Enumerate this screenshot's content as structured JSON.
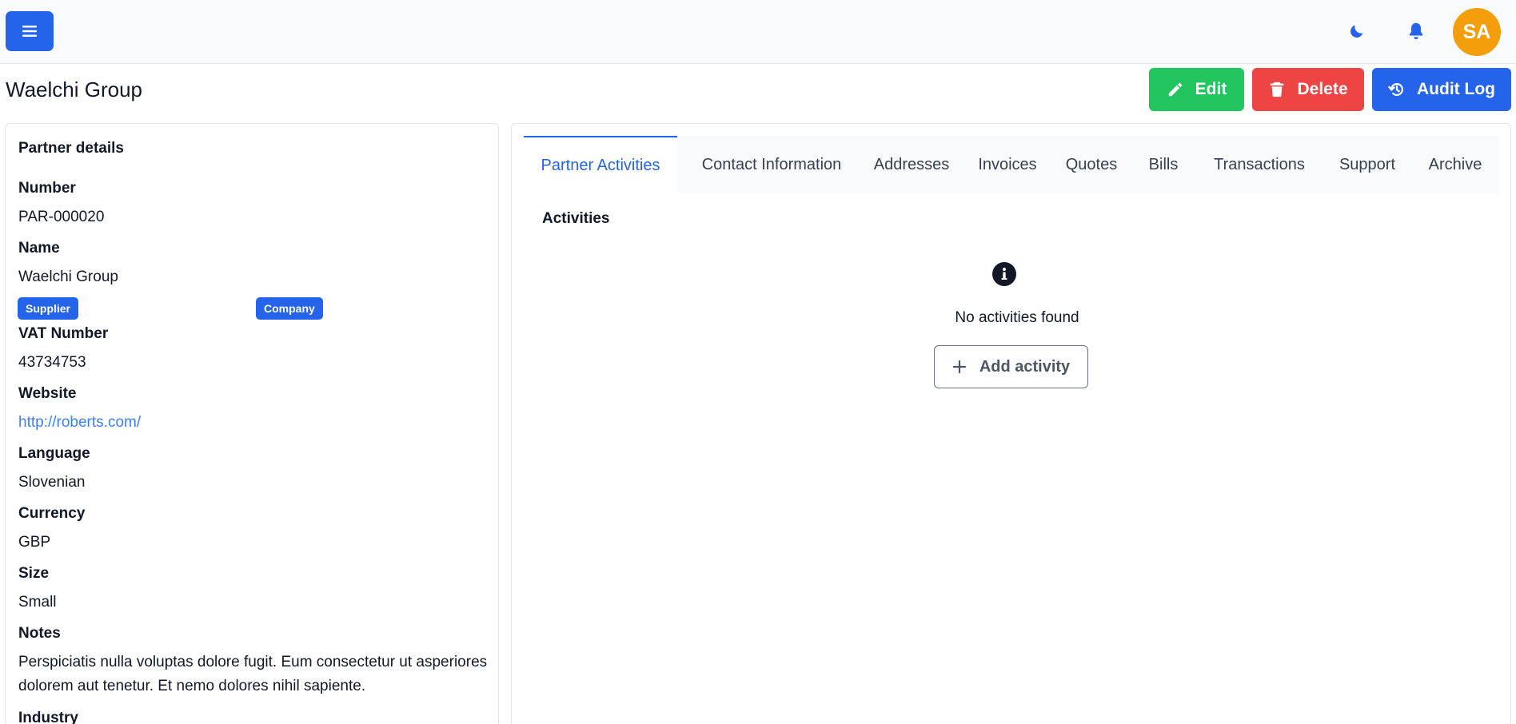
{
  "topbar": {
    "menu_icon": "hamburger-icon",
    "theme_icon": "moon-icon",
    "notification_icon": "bell-icon",
    "avatar_initials": "SA",
    "avatar_color": "#f59e0b"
  },
  "page": {
    "title": "Waelchi Group"
  },
  "actions": {
    "edit_label": "Edit",
    "delete_label": "Delete",
    "audit_label": "Audit Log",
    "edit_color": "#22c55e",
    "delete_color": "#ef4444",
    "audit_color": "#2563eb"
  },
  "partner": {
    "heading": "Partner details",
    "number_label": "Number",
    "number_value": "PAR-000020",
    "name_label": "Name",
    "name_value": "Waelchi Group",
    "badges": [
      "Supplier",
      "Company"
    ],
    "vat_label": "VAT Number",
    "vat_value": "43734753",
    "website_label": "Website",
    "website_value": "http://roberts.com/",
    "language_label": "Language",
    "language_value": "Slovenian",
    "currency_label": "Currency",
    "currency_value": "GBP",
    "size_label": "Size",
    "size_value": "Small",
    "notes_label": "Notes",
    "notes_value": "Perspiciatis nulla voluptas dolore fugit. Eum consectetur ut asperiores dolorem aut tenetur. Et nemo dolores nihil sapiente.",
    "industry_label": "Industry"
  },
  "tabs": [
    {
      "label": "Partner Activities",
      "active": true
    },
    {
      "label": "Contact Information",
      "active": false
    },
    {
      "label": "Addresses",
      "active": false
    },
    {
      "label": "Invoices",
      "active": false
    },
    {
      "label": "Quotes",
      "active": false
    },
    {
      "label": "Bills",
      "active": false
    },
    {
      "label": "Transactions",
      "active": false
    },
    {
      "label": "Support",
      "active": false
    },
    {
      "label": "Archive",
      "active": false
    }
  ],
  "activities": {
    "title": "Activities",
    "empty_icon": "info-icon",
    "empty_text": "No activities found",
    "add_label": "Add activity"
  },
  "colors": {
    "primary": "#2563eb",
    "link": "#3b82f6"
  }
}
